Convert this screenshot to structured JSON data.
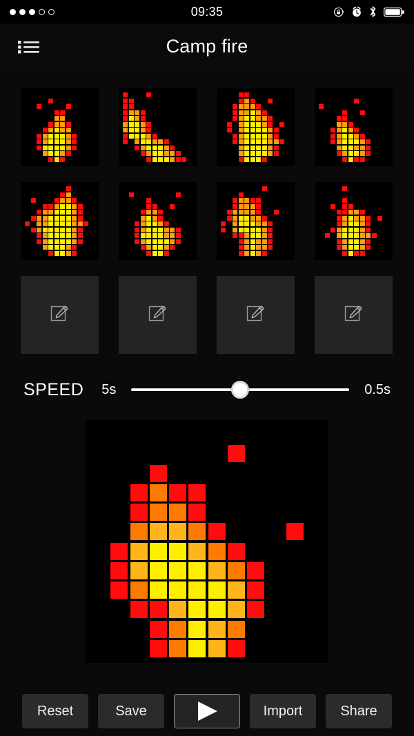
{
  "status_bar": {
    "signal_dots": [
      true,
      true,
      true,
      false,
      false
    ],
    "time": "09:35",
    "icons": [
      "rotation-lock-icon",
      "alarm-clock-icon",
      "bluetooth-icon",
      "battery-full-icon"
    ],
    "battery_level": 100
  },
  "header": {
    "menu_icon": "list-menu-icon",
    "title": "Camp fire"
  },
  "palette": {
    "off": "#000000",
    "red": "#FF0C0C",
    "orange_dark": "#FF7A00",
    "orange": "#FF9D10",
    "amber": "#FFB41A",
    "yellow": "#FFEE00",
    "empty_slot_bg": "#242424",
    "panel_bg": "#0A0A0A",
    "button_bg": "#2B2B2D"
  },
  "frames_panel": {
    "grid_size": 12,
    "columns": 4,
    "rows": 3,
    "empty_slot_icon": "edit-pencil-square-icon",
    "empty_slot_count": 4,
    "frames": [
      {
        "index": 1,
        "name": "frame-1",
        "cells": [
          "............",
          "....R.......",
          "..R....R....",
          ".....RR.....",
          ".....OO.....",
          "....ROOR....",
          "...ROYOO....",
          "..ROYYYOR...",
          "..ROYYYOR...",
          "..RYYYYOR...",
          "...OYYOR....",
          "....RYR....."
        ]
      },
      {
        "index": 2,
        "name": "frame-2",
        "cells": [
          "R...R.......",
          "RR..........",
          "RR..........",
          "ROOR........",
          "RYOR........",
          "OYYOR.......",
          "OYYOR.......",
          "RYYYOR......",
          "R.OYYOOR....",
          "..ROYYYOR...",
          "...ROYYOOR..",
          "....RYYYORR."
        ]
      },
      {
        "index": 3,
        "name": "frame-3",
        "cells": [
          "...RR.......",
          "...ROR..R...",
          "..ROOOR.....",
          "..ROOYOR....",
          "..ROYYOOR...",
          ".R.OYYYOR.R.",
          ".R.OYYYYOR..",
          "..ROYYYYOR..",
          "..ROYYYYOOR.",
          "...OYYYYOR..",
          "...OYYYYOR..",
          "...RYYYR...."
        ]
      },
      {
        "index": 4,
        "name": "frame-4",
        "cells": [
          "............",
          "......R.....",
          "R...........",
          "....R..R....",
          "...RR.......",
          "...OOR......",
          "..ROYOR.....",
          "..ROYYOR....",
          "..ROYYYOR...",
          "...OYYOOR...",
          "...ROYYOR...",
          "....RYRR...."
        ]
      },
      {
        "index": 5,
        "name": "frame-5",
        "cells": [
          ".......R....",
          "......RO....",
          ".R...ROOR...",
          "...RROYYOR..",
          "..ROOYYYOR..",
          ".ROOYYYYOR..",
          "R.OOYYYYOOR.",
          ".ROYYYYYOR..",
          "..ROYYYYOR..",
          "..ROYYYYOR..",
          "...OYYYOR...",
          "....RYYOR..."
        ]
      },
      {
        "index": 6,
        "name": "frame-6",
        "cells": [
          "............",
          ".R.......R..",
          "....R.......",
          "....RR..R...",
          "...ROOR.....",
          "...OYOR.....",
          "..ROYYOR....",
          "..ROYYYOOR..",
          "..RYYYYOOR..",
          "..ROYYYYOR..",
          "...ROYYOR...",
          "....RYYR...."
        ]
      },
      {
        "index": 7,
        "name": "frame-7",
        "cells": [
          ".......R....",
          "...R........",
          "..ROORR.....",
          "..ROOOR.....",
          ".ROOOOR..R..",
          ".ROYYOOR....",
          "R.OYYYOOR...",
          "R.OYYYYOR...",
          "..RROYYOR...",
          "...ROYOOR...",
          "...ROYOOR...",
          "...ROYOR...."
        ]
      },
      {
        "index": 8,
        "name": "frame-8",
        "cells": [
          "....R.......",
          "............",
          "....R.......",
          "..R.RR......",
          "...RROOR....",
          "...ROYOOR.R.",
          "...ROYYOR...",
          "..ROYYYOR...",
          ".R.OYYYOOR..",
          "...ROYYOR...",
          "...ROYYOR...",
          "....RYRR...."
        ]
      }
    ]
  },
  "speed_control": {
    "label": "SPEED",
    "min_label": "5s",
    "max_label": "0.5s",
    "value_percent": 50
  },
  "preview": {
    "name": "pixel-editor-canvas",
    "grid_size": 12,
    "cells": [
      "............",
      ".......R....",
      "...R........",
      "..ROORR.....",
      "..ROOOR.....",
      "..OAAOR..R..",
      ".RAYYOOR....",
      "RAYYYAOR....",
      "RoYYYYAR....",
      ".RRAYYAR....",
      "...RoYoo....",
      "...RoYoR...."
    ],
    "cells_detailed": [
      [
        ".",
        ".",
        ".",
        ".",
        ".",
        ".",
        ".",
        ".",
        ".",
        ".",
        ".",
        "."
      ],
      [
        ".",
        ".",
        ".",
        ".",
        ".",
        ".",
        ".",
        "R",
        ".",
        ".",
        ".",
        "."
      ],
      [
        ".",
        ".",
        ".",
        "R",
        ".",
        ".",
        ".",
        ".",
        ".",
        ".",
        ".",
        "."
      ],
      [
        ".",
        ".",
        "R",
        "o",
        "R",
        "R",
        ".",
        ".",
        ".",
        ".",
        ".",
        "."
      ],
      [
        ".",
        ".",
        "R",
        "o",
        "o",
        "R",
        ".",
        ".",
        ".",
        ".",
        ".",
        "."
      ],
      [
        ".",
        ".",
        "o",
        "A",
        "A",
        "o",
        "R",
        ".",
        ".",
        ".",
        "R",
        "."
      ],
      [
        ".",
        "R",
        "A",
        "Y",
        "Y",
        "A",
        "o",
        "R",
        ".",
        ".",
        ".",
        "."
      ],
      [
        ".",
        "R",
        "A",
        "Y",
        "Y",
        "Y",
        "A",
        "o",
        "R",
        ".",
        ".",
        "."
      ],
      [
        ".",
        "R",
        "o",
        "Y",
        "Y",
        "Y",
        "Y",
        "A",
        "R",
        ".",
        ".",
        "."
      ],
      [
        ".",
        ".",
        "R",
        "R",
        "A",
        "Y",
        "Y",
        "A",
        "R",
        ".",
        ".",
        "."
      ],
      [
        ".",
        ".",
        ".",
        "R",
        "o",
        "Y",
        "A",
        "o",
        ".",
        ".",
        ".",
        "."
      ],
      [
        ".",
        ".",
        ".",
        "R",
        "o",
        "Y",
        "A",
        "R",
        ".",
        ".",
        ".",
        "."
      ]
    ]
  },
  "toolbar": {
    "reset_label": "Reset",
    "save_label": "Save",
    "play_icon": "play-triangle-icon",
    "import_label": "Import",
    "share_label": "Share"
  }
}
